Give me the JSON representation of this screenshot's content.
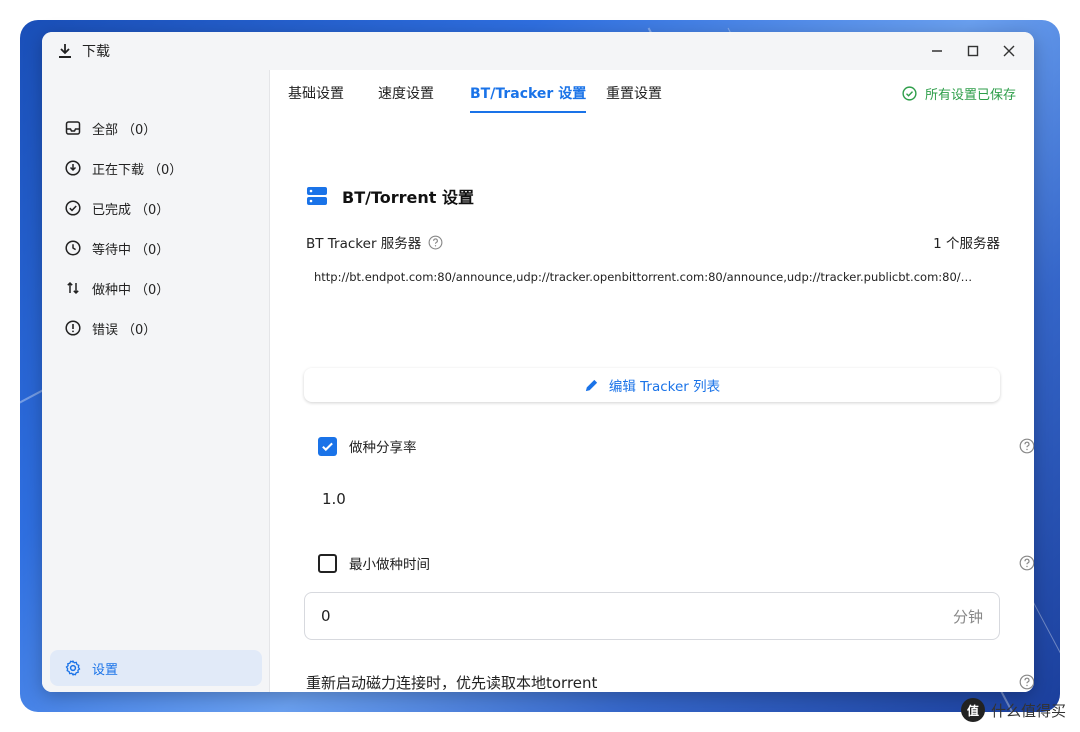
{
  "window": {
    "title": "下载"
  },
  "sidebar": {
    "items": [
      {
        "label": "全部",
        "count": "（0）",
        "icon": "inbox-icon"
      },
      {
        "label": "正在下载",
        "count": "（0）",
        "icon": "download-circle-icon"
      },
      {
        "label": "已完成",
        "count": "（0）",
        "icon": "check-circle-icon"
      },
      {
        "label": "等待中",
        "count": "（0）",
        "icon": "clock-icon"
      },
      {
        "label": "做种中",
        "count": "（0）",
        "icon": "up-down-arrows-icon"
      },
      {
        "label": "错误",
        "count": "（0）",
        "icon": "error-circle-icon"
      }
    ],
    "settings_label": "设置"
  },
  "tabs": [
    {
      "label": "基础设置"
    },
    {
      "label": "速度设置"
    },
    {
      "label": "BT/Tracker 设置",
      "active": true
    },
    {
      "label": "重置设置"
    }
  ],
  "status": {
    "saved": "所有设置已保存"
  },
  "section": {
    "title": "BT/Torrent 设置"
  },
  "tracker": {
    "label": "BT Tracker 服务器",
    "count": "1 个服务器",
    "value": "http://bt.endpot.com:80/announce,udp://tracker.openbittorrent.com:80/announce,udp://tracker.publicbt.com:80/…",
    "edit_button": "编辑 Tracker 列表"
  },
  "seed_ratio": {
    "label": "做种分享率",
    "checked": true,
    "value": "1.0"
  },
  "seed_time": {
    "label": "最小做种时间",
    "checked": false,
    "value": "0",
    "unit": "分钟"
  },
  "magnet": {
    "label": "重新启动磁力连接时，优先读取本地torrent"
  },
  "watermark": {
    "logo": "值",
    "text": "什么值得买"
  },
  "colors": {
    "accent": "#1a73e8",
    "success": "#2e9e4a",
    "sidebar_bg": "#f4f5f7"
  }
}
